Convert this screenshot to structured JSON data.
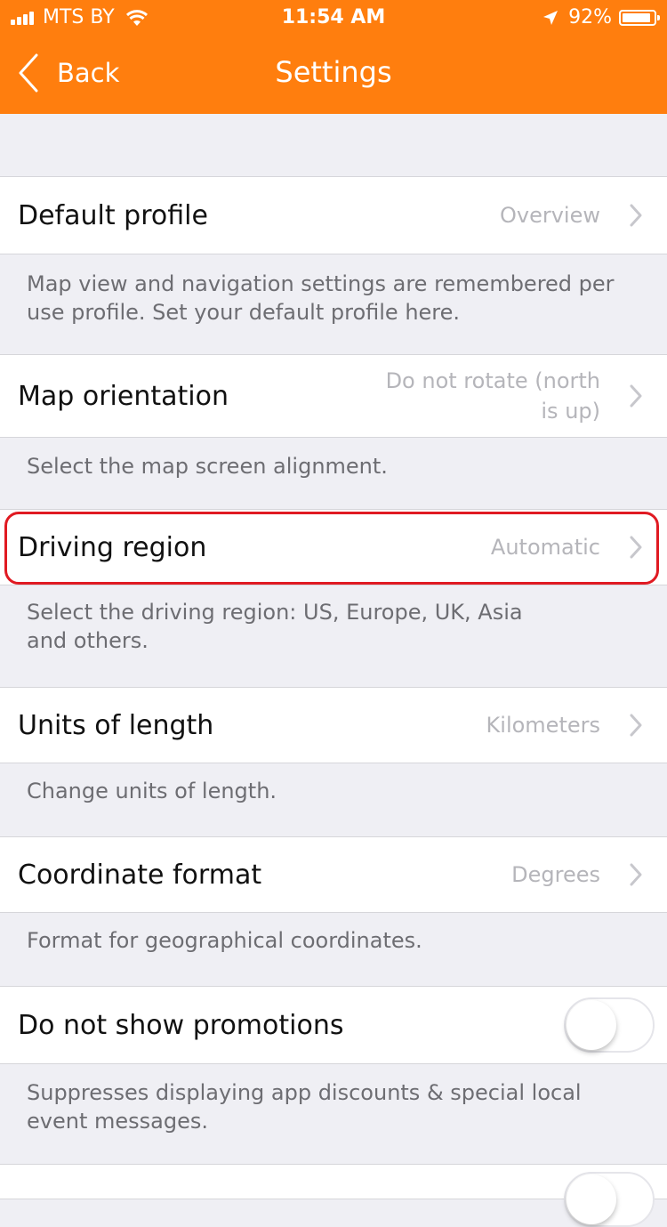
{
  "status_bar": {
    "carrier": "MTS BY",
    "time": "11:54 AM",
    "battery": "92%",
    "battery_level": 0.92
  },
  "nav": {
    "back_label": "Back",
    "title": "Settings"
  },
  "rows": {
    "default_profile": {
      "label": "Default profile",
      "value": "Overview"
    },
    "default_profile_footer": "Map view and navigation settings are remembered per use profile. Set your default profile here.",
    "map_orientation": {
      "label": "Map orientation",
      "value_line1": "Do not rotate (north",
      "value_line2": "is up)"
    },
    "map_orientation_footer": "Select the map screen alignment.",
    "driving_region": {
      "label": "Driving region",
      "value": "Automatic"
    },
    "driving_region_footer_line1": "Select the driving region: US, Europe, UK, Asia",
    "driving_region_footer_line2": "and others.",
    "units_of_length": {
      "label": "Units of length",
      "value": "Kilometers"
    },
    "units_of_length_footer": "Change units of length.",
    "coordinate_format": {
      "label": "Coordinate format",
      "value": "Degrees"
    },
    "coordinate_format_footer": "Format for geographical coordinates.",
    "promotions": {
      "label": "Do not show promotions",
      "enabled": false
    },
    "promotions_footer": "Suppresses displaying app discounts & special local event messages."
  },
  "colors": {
    "accent": "#ff7e0e",
    "highlight": "#e01a22",
    "background": "#efeff4"
  },
  "icons": {
    "back": "chevron-left-icon",
    "disclosure": "chevron-right-icon",
    "wifi": "wifi-icon",
    "location": "location-arrow-icon",
    "battery": "battery-icon",
    "signal": "signal-bars-icon"
  }
}
